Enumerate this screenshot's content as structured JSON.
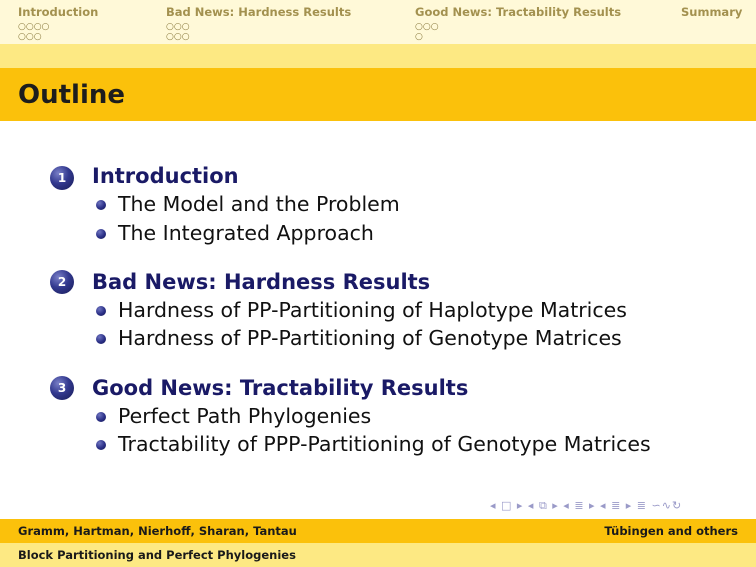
{
  "header": {
    "sections": [
      {
        "label": "Introduction",
        "dots_row1": "○○○○",
        "dots_row2": "○○○"
      },
      {
        "label": "Bad News: Hardness Results",
        "dots_row1": "○○○",
        "dots_row2": "○○○"
      },
      {
        "label": "Good News: Tractability Results",
        "dots_row1": "○○○",
        "dots_row2": "○"
      },
      {
        "label": "Summary"
      }
    ]
  },
  "frame": {
    "title": "Outline"
  },
  "outline": [
    {
      "number": "1",
      "title": "Introduction",
      "items": [
        "The Model and the Problem",
        "The Integrated Approach"
      ]
    },
    {
      "number": "2",
      "title": "Bad News: Hardness Results",
      "items": [
        "Hardness of PP-Partitioning of Haplotype Matrices",
        "Hardness of PP-Partitioning of Genotype Matrices"
      ]
    },
    {
      "number": "3",
      "title": "Good News: Tractability Results",
      "items": [
        "Perfect Path Phylogenies",
        "Tractability of PPP-Partitioning of Genotype Matrices"
      ]
    }
  ],
  "navigation": {
    "symbols": "◂ □ ▸ ◂ ⧉ ▸ ◂ ≣ ▸ ◂ ≣ ▸ ≣ ∽∿↻"
  },
  "footer": {
    "authors": "Gramm, Hartman, Nierhoff, Sharan, Tantau",
    "institute": "Tübingen and others",
    "title": "Block Partitioning and Perfect Phylogenies"
  },
  "colors": {
    "header_bg": "#fff9d8",
    "band_light": "#fde983",
    "band_dark": "#fbc10b",
    "title_blue": "#1a1a66"
  }
}
